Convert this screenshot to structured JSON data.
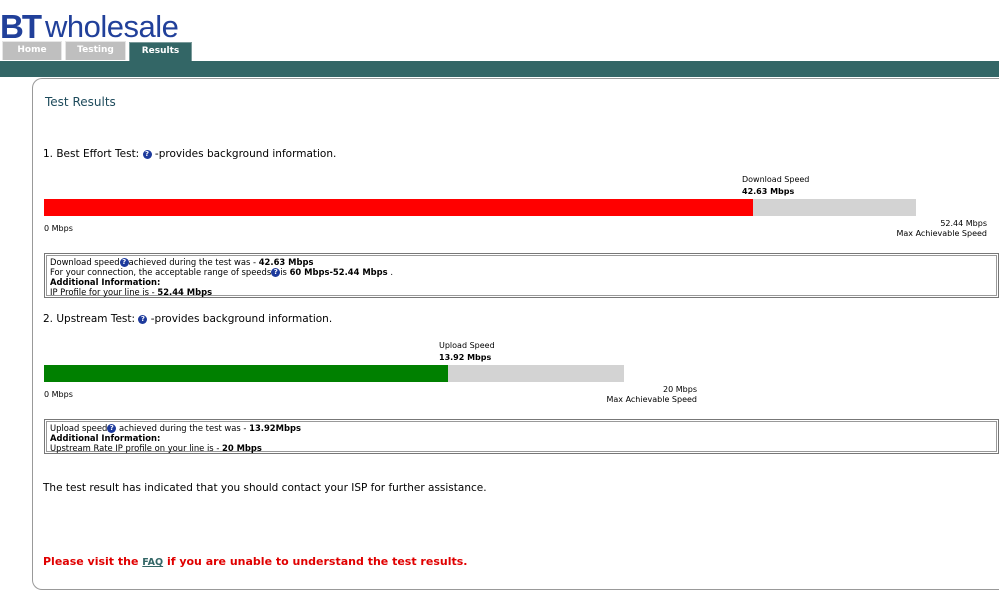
{
  "header": {
    "logo_bt": "BT",
    "logo_wholesale": "wholesale",
    "tabs": [
      {
        "label": "Home"
      },
      {
        "label": "Testing"
      },
      {
        "label": "Results"
      }
    ]
  },
  "main": {
    "title": "Test Results",
    "best_effort": {
      "heading_prefix": "1. Best Effort Test:",
      "heading_suffix": "-provides background information.",
      "speed_label": "Download Speed",
      "speed_value": "42.63 Mbps",
      "min_label": "0 Mbps",
      "max_value": "52.44 Mbps",
      "max_label": "Max Achievable Speed",
      "fill_fraction": 0.813,
      "fill_color": "#ff0000",
      "info": {
        "line1_prefix": "Download speed",
        "line1_mid": "achieved during the test was - ",
        "line1_value": "42.63 Mbps",
        "line2_prefix": "For your connection, the acceptable range of speeds",
        "line2_mid": "is ",
        "line2_value": "60 Mbps-52.44 Mbps",
        "line2_end": " .",
        "line3": "Additional Information:",
        "line4_prefix": "IP Profile for your line is - ",
        "line4_value": "52.44 Mbps"
      }
    },
    "upstream": {
      "heading_prefix": "2. Upstream Test:",
      "heading_suffix": "-provides background information.",
      "speed_label": "Upload Speed",
      "speed_value": "13.92 Mbps",
      "min_label": "0 Mbps",
      "max_value": "20 Mbps",
      "max_label": "Max Achievable Speed",
      "fill_fraction": 0.696,
      "fill_color": "#008000",
      "info": {
        "line1_prefix": "Upload speed",
        "line1_mid": " achieved during the test was - ",
        "line1_value": "13.92Mbps",
        "line2": "Additional Information:",
        "line3_prefix": "Upstream Rate IP profile on your line is - ",
        "line3_value": "20 Mbps"
      }
    },
    "message": "The test result has indicated that you should contact your ISP for further assistance.",
    "faq": {
      "prefix": "Please visit the ",
      "link": "FAQ",
      "suffix": " if you are unable to understand the test results."
    },
    "help_icon": "question-circle-icon"
  }
}
